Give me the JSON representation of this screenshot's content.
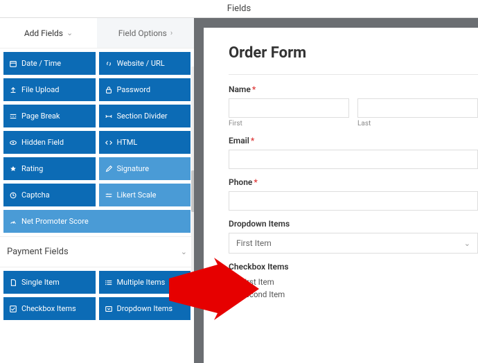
{
  "header": {
    "title": "Fields"
  },
  "tabs": {
    "add": "Add Fields",
    "options": "Field Options"
  },
  "fancy_fields": [
    {
      "label": "Date / Time",
      "icon": "calendar-icon"
    },
    {
      "label": "Website / URL",
      "icon": "link-icon"
    },
    {
      "label": "File Upload",
      "icon": "upload-icon"
    },
    {
      "label": "Password",
      "icon": "lock-icon"
    },
    {
      "label": "Page Break",
      "icon": "pagebreak-icon"
    },
    {
      "label": "Section Divider",
      "icon": "divider-icon"
    },
    {
      "label": "Hidden Field",
      "icon": "eye-icon"
    },
    {
      "label": "HTML",
      "icon": "code-icon"
    },
    {
      "label": "Rating",
      "icon": "star-icon"
    },
    {
      "label": "Signature",
      "icon": "pen-icon",
      "light": true
    },
    {
      "label": "Captcha",
      "icon": "captcha-icon"
    },
    {
      "label": "Likert Scale",
      "icon": "scale-icon",
      "light": true
    },
    {
      "label": "Net Promoter Score",
      "icon": "gauge-icon",
      "full": true,
      "light": true
    }
  ],
  "section": {
    "title": "Payment Fields"
  },
  "payment_fields": [
    {
      "label": "Single Item",
      "icon": "file-icon"
    },
    {
      "label": "Multiple Items",
      "icon": "list-icon"
    },
    {
      "label": "Checkbox Items",
      "icon": "checkbox-icon"
    },
    {
      "label": "Dropdown Items",
      "icon": "dropdown-icon"
    }
  ],
  "form": {
    "title": "Order Form",
    "name": {
      "label": "Name",
      "first": "First",
      "last": "Last"
    },
    "email": {
      "label": "Email"
    },
    "phone": {
      "label": "Phone"
    },
    "dropdown": {
      "label": "Dropdown Items",
      "selected": "First Item"
    },
    "checkbox": {
      "label": "Checkbox Items",
      "items": [
        "First Item",
        "Second Item"
      ]
    }
  }
}
